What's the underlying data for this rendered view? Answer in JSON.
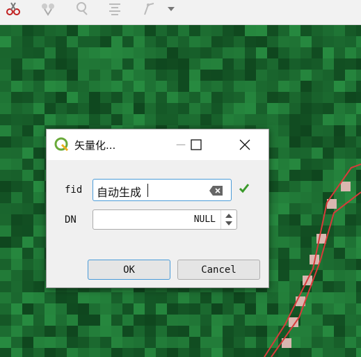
{
  "toolbar": {
    "icons": [
      "scissors-icon",
      "merge-features-icon",
      "split-features-icon",
      "align-icon",
      "digitize-dropdown-icon"
    ]
  },
  "dialog": {
    "title": "矢量化...",
    "app_icon": "qgis-icon",
    "minimize_glyph": "—",
    "fields": [
      {
        "label": "fid",
        "value": "自动生成",
        "clear_icon": "clear-text-icon",
        "status_icon": "check-icon",
        "status_color": "#3a9a2a"
      },
      {
        "label": "DN",
        "value": "NULL",
        "spinner_icon": "spinbox-arrows-icon"
      }
    ],
    "ok_label": "OK",
    "cancel_label": "Cancel"
  },
  "colors": {
    "accent": "#4a9bd8",
    "polygon_outline": "#d83a3a",
    "map_green": "#1f6a35"
  }
}
